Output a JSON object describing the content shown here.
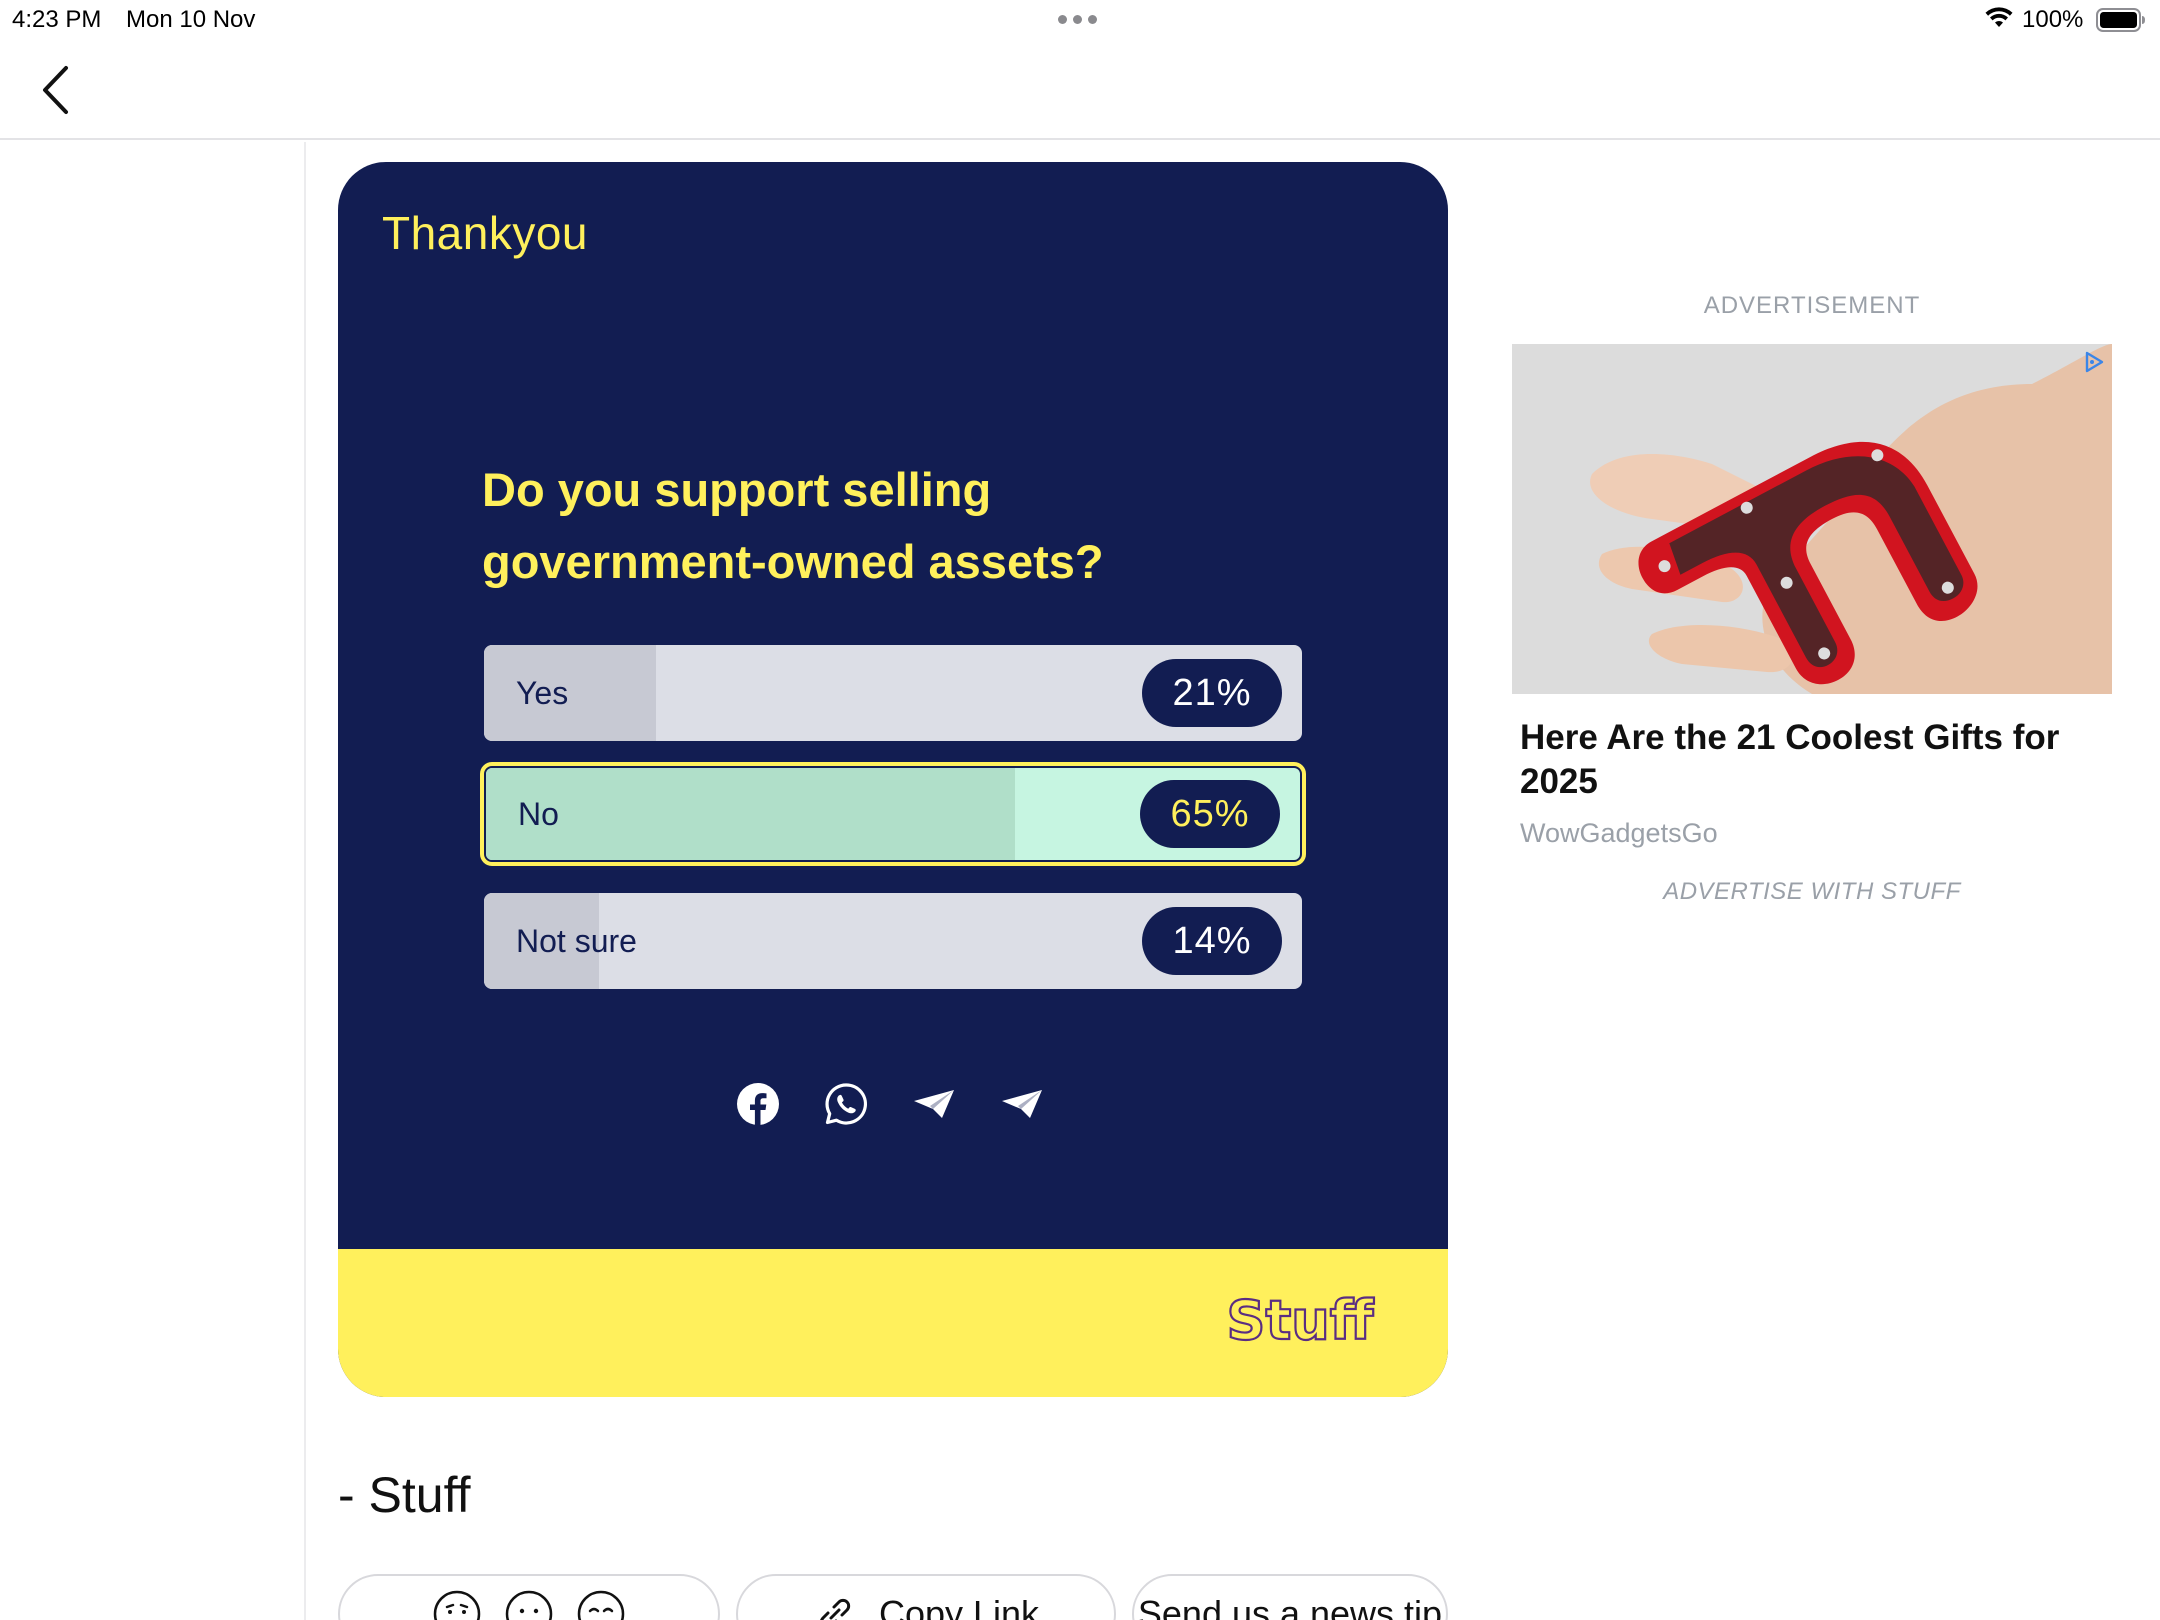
{
  "status_bar": {
    "time": "4:23 PM",
    "date": "Mon 10 Nov",
    "battery": "100%"
  },
  "nav": {
    "back_icon": "chevron-left-icon"
  },
  "poll": {
    "heading": "Thankyou",
    "question": "Do you support selling government-owned assets?",
    "options": [
      {
        "label": "Yes",
        "percent_text": "21%",
        "percent": 21,
        "selected": false
      },
      {
        "label": "No",
        "percent_text": "65%",
        "percent": 65,
        "selected": true
      },
      {
        "label": "Not sure",
        "percent_text": "14%",
        "percent": 14,
        "selected": false
      }
    ],
    "share_icons": [
      "facebook-icon",
      "whatsapp-icon",
      "telegram-icon",
      "send-icon"
    ],
    "brand": "Stuff",
    "colors": {
      "card": "#121d52",
      "accent": "#fff05c",
      "selected": "#c6f5e1"
    }
  },
  "signature": "- Stuff",
  "bottom_buttons": {
    "copy_link": "Copy Link",
    "news_tip": "Send us a news tip"
  },
  "ad": {
    "label": "ADVERTISEMENT",
    "title": "Here Are the 21 Coolest Gifts for 2025",
    "source": "WowGadgetsGo",
    "advertise_link": "ADVERTISE WITH STUFF"
  }
}
